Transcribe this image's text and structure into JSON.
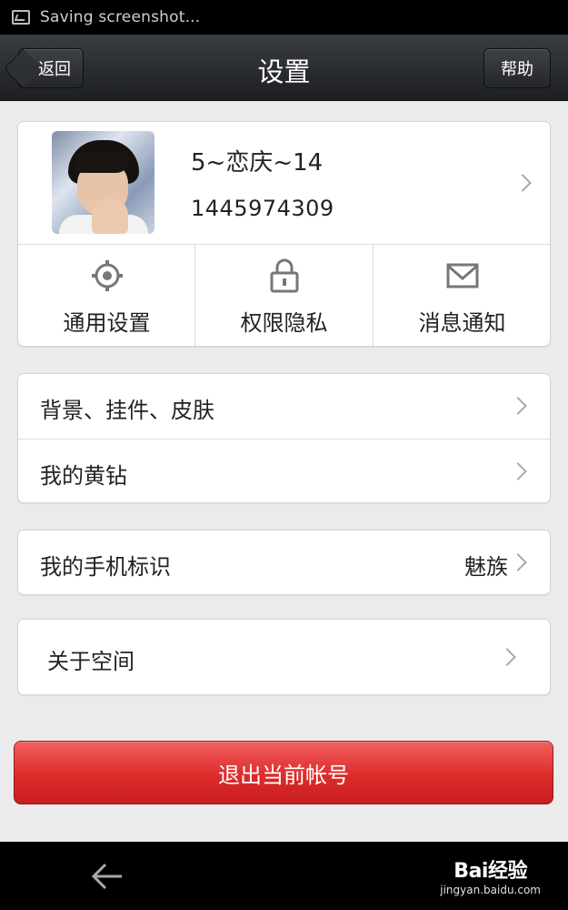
{
  "status_bar": {
    "text": "Saving screenshot...",
    "icon": "image-icon"
  },
  "title_bar": {
    "back_label": "返回",
    "title": "设置",
    "help_label": "帮助"
  },
  "profile": {
    "name": "5~恋庆~14",
    "id": "1445974309",
    "avatar": "avatar-photo"
  },
  "shortcuts": [
    {
      "label": "通用设置",
      "icon": "gear-icon"
    },
    {
      "label": "权限隐私",
      "icon": "lock-icon"
    },
    {
      "label": "消息通知",
      "icon": "mail-icon"
    }
  ],
  "menu": {
    "group1": [
      {
        "label": "背景、挂件、皮肤"
      },
      {
        "label": "我的黄钻"
      }
    ],
    "group2": [
      {
        "label": "我的手机标识",
        "value": "魅族"
      }
    ],
    "group3": [
      {
        "label": "关于空间"
      }
    ]
  },
  "logout_label": "退出当前帐号",
  "watermark": {
    "brand": "Bai经验",
    "url": "jingyan.baidu.com"
  },
  "colors": {
    "title_bar": "#2a2c31",
    "logout": "#dd2b2b",
    "background": "#ebebeb"
  }
}
